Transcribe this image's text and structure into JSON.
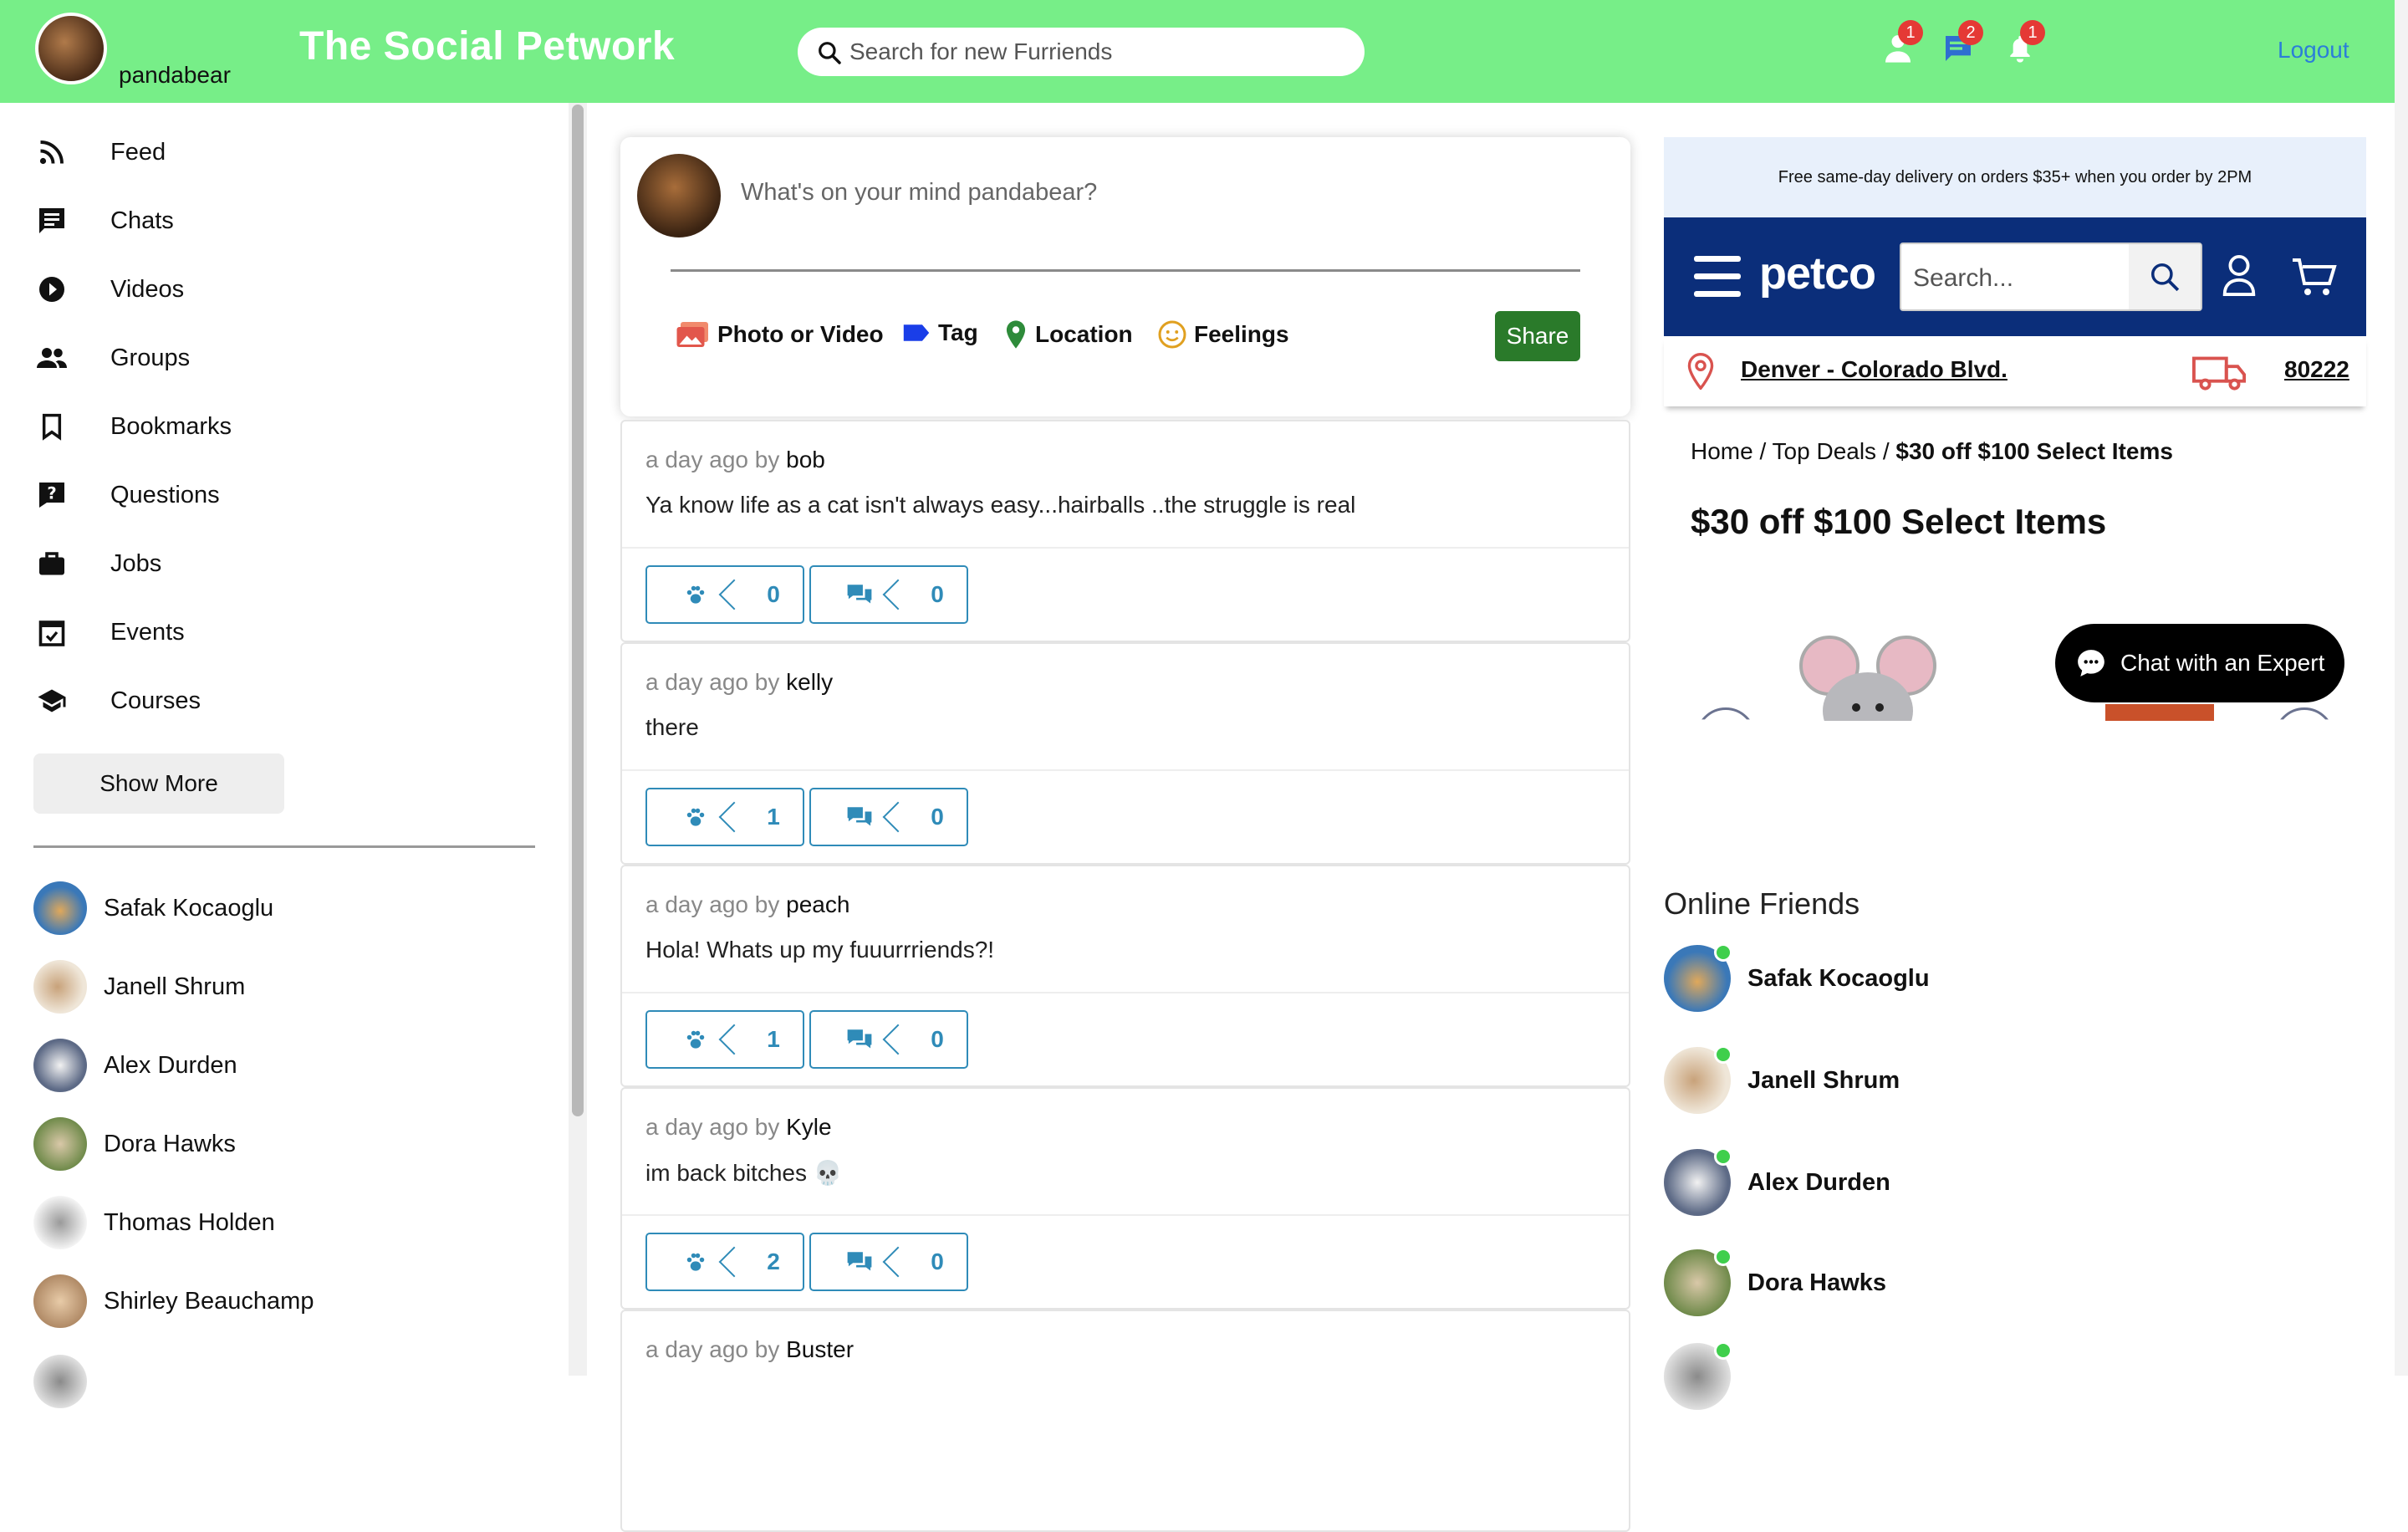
{
  "header": {
    "username": "pandabear",
    "brand": "The Social Petwork",
    "search_placeholder": "Search for new Furriends",
    "notifications": [
      {
        "icon": "friend-request-icon",
        "count": "1"
      },
      {
        "icon": "chat-icon",
        "count": "2"
      },
      {
        "icon": "bell-icon",
        "count": "1"
      }
    ],
    "logout": "Logout"
  },
  "sidebar": {
    "items": [
      {
        "label": "Feed",
        "icon": "rss-icon"
      },
      {
        "label": "Chats",
        "icon": "chat-icon"
      },
      {
        "label": "Videos",
        "icon": "play-circle-icon"
      },
      {
        "label": "Groups",
        "icon": "group-icon"
      },
      {
        "label": "Bookmarks",
        "icon": "bookmark-icon"
      },
      {
        "label": "Questions",
        "icon": "question-icon"
      },
      {
        "label": "Jobs",
        "icon": "briefcase-icon"
      },
      {
        "label": "Events",
        "icon": "calendar-icon"
      },
      {
        "label": "Courses",
        "icon": "school-icon"
      }
    ],
    "show_more": "Show More",
    "friends": [
      "Safak Kocaoglu",
      "Janell Shrum",
      "Alex Durden",
      "Dora Hawks",
      "Thomas Holden",
      "Shirley Beauchamp"
    ]
  },
  "composer": {
    "prompt": "What's on your mind pandabear?",
    "options": [
      "Photo or Video",
      "Tag",
      "Location",
      "Feelings"
    ],
    "share": "Share"
  },
  "posts": [
    {
      "time": "a day ago by",
      "author": "bob",
      "text": "Ya know life as a cat isn't always easy...hairballs ..the struggle is real",
      "likes": "0",
      "comments": "0"
    },
    {
      "time": "a day ago by",
      "author": "kelly",
      "text": "there",
      "likes": "1",
      "comments": "0"
    },
    {
      "time": "a day ago by",
      "author": "peach",
      "text": "Hola! Whats up my fuuurrriends?!",
      "likes": "1",
      "comments": "0"
    },
    {
      "time": "a day ago by",
      "author": "Kyle",
      "text": "im back bitches 💀",
      "likes": "2",
      "comments": "0"
    },
    {
      "time": "a day ago by",
      "author": "Buster",
      "text": "",
      "likes": "",
      "comments": ""
    }
  ],
  "ad": {
    "banner": "Free same-day delivery on orders $35+ when you order by 2PM",
    "logo": "petco",
    "search_placeholder": "Search...",
    "store": "Denver - Colorado Blvd.",
    "zip": "80222",
    "breadcrumb": {
      "home": "Home",
      "sep": "/",
      "deals": "Top Deals",
      "current": "$30 off $100 Select Items"
    },
    "title": "$30 off $100 Select Items",
    "chat_expert": "Chat with an Expert"
  },
  "online": {
    "title": "Online Friends",
    "friends": [
      "Safak Kocaoglu",
      "Janell Shrum",
      "Alex Durden",
      "Dora Hawks"
    ]
  },
  "colors": {
    "topbar": "#77ee88",
    "link": "#2b7ed8",
    "share": "#2a7a2a",
    "reaction": "#2f8bb8",
    "petco_navy": "#0b2e7a",
    "online_dot": "#3fcf4c",
    "badge": "#e53935"
  }
}
